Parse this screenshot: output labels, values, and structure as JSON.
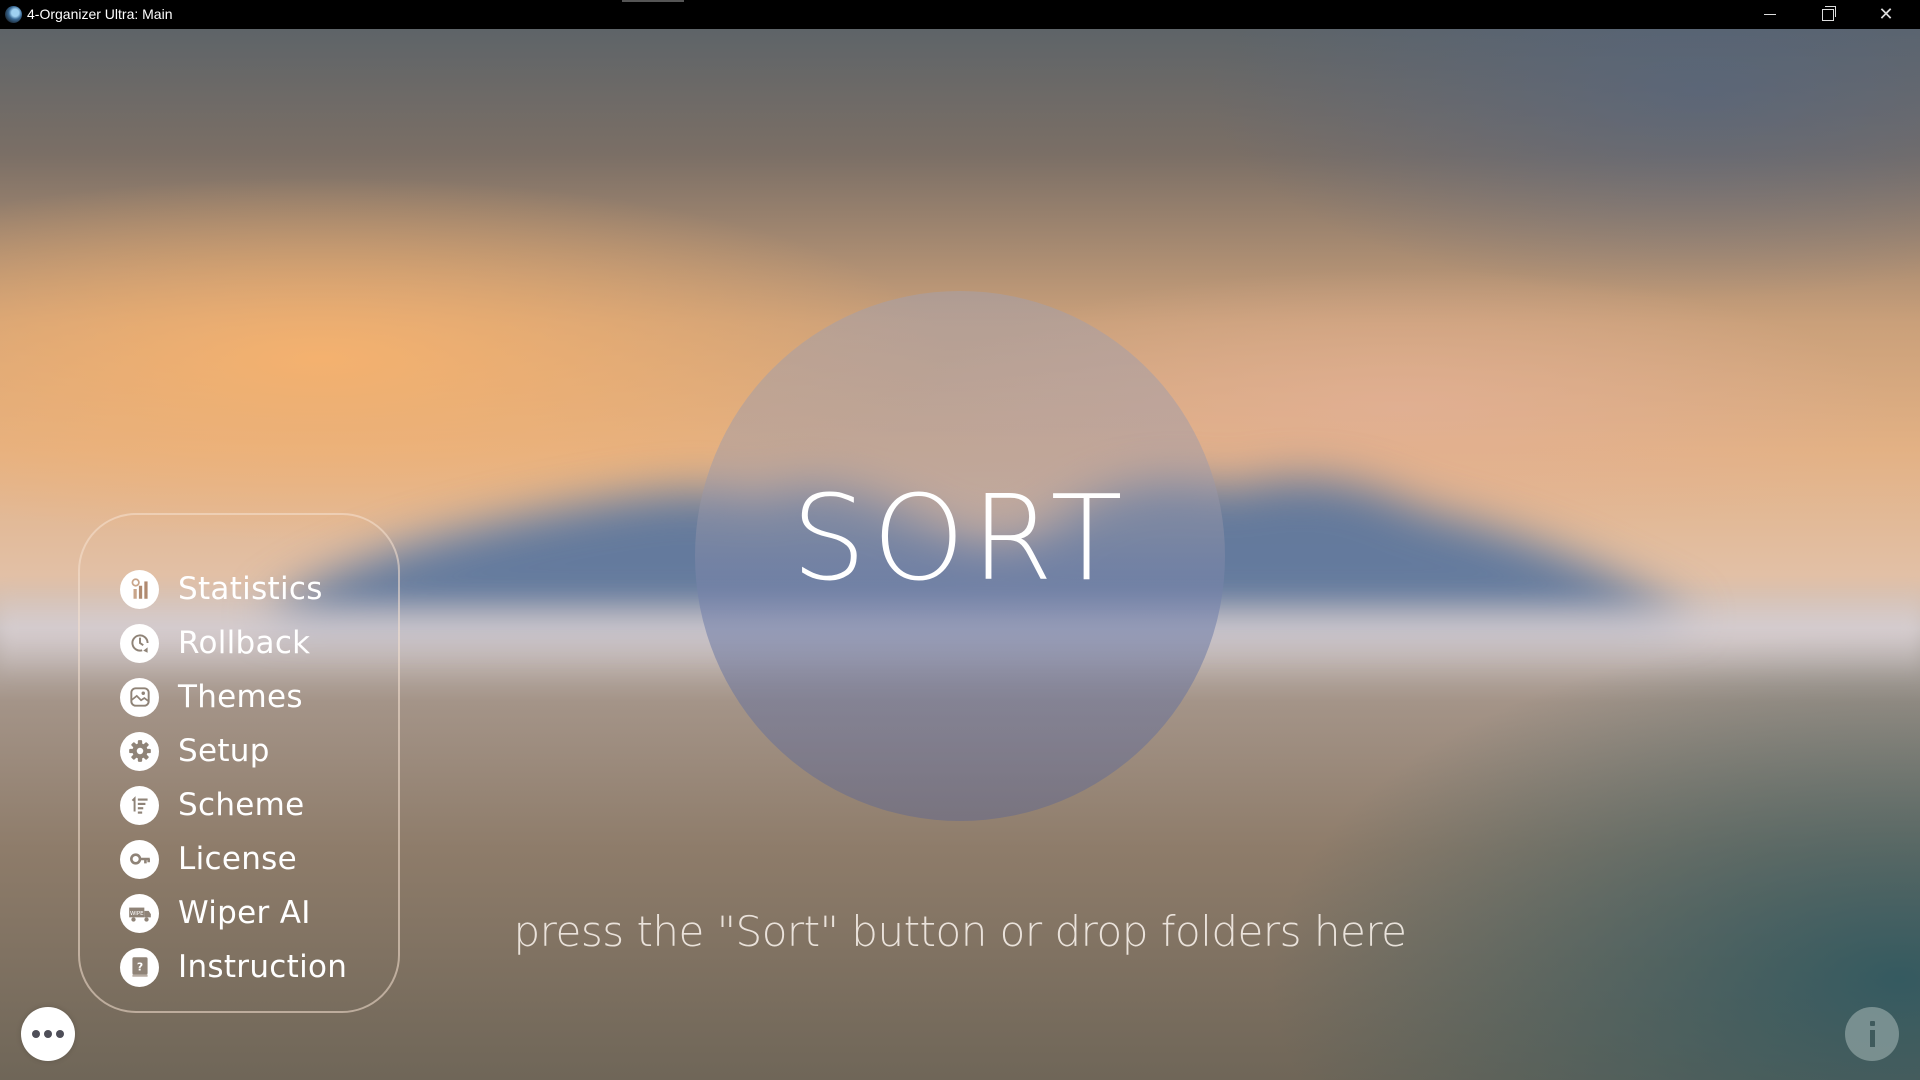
{
  "window": {
    "title": "4-Organizer Ultra: Main",
    "controls": {
      "minimize": "minimize",
      "maximize": "restore",
      "close": "close"
    }
  },
  "main": {
    "sort_button_label": "SORT",
    "hint": "press the \"Sort\" button or drop folders here"
  },
  "menu": {
    "items": [
      {
        "label": "Statistics",
        "icon": "bar-chart-icon"
      },
      {
        "label": "Rollback",
        "icon": "rollback-clock-icon"
      },
      {
        "label": "Themes",
        "icon": "image-icon"
      },
      {
        "label": "Setup",
        "icon": "gear-icon"
      },
      {
        "label": "Scheme",
        "icon": "numbered-list-icon"
      },
      {
        "label": "License",
        "icon": "key-icon"
      },
      {
        "label": "Wiper AI",
        "icon": "wipe-truck-icon"
      },
      {
        "label": "Instruction",
        "icon": "help-book-icon"
      }
    ]
  },
  "footer": {
    "more_icon": "more-dots-icon",
    "info_icon": "info-icon"
  },
  "colors": {
    "titlebar": "#000000",
    "text": "#ffffff",
    "icon_glyph": "#8f8377",
    "info_button": "#8ca0a0"
  }
}
